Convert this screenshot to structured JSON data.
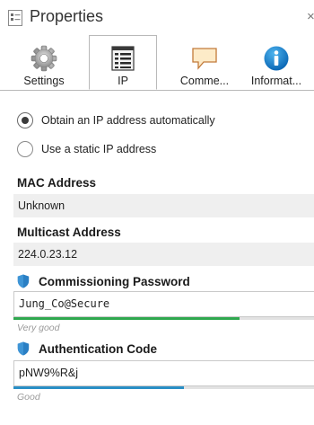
{
  "header": {
    "title": "Properties",
    "close_glyph": "×",
    "title_icon": "properties-icon"
  },
  "tabs": [
    {
      "label": "Settings",
      "icon": "gear-icon",
      "active": false
    },
    {
      "label": "IP",
      "icon": "ip-list-icon",
      "active": true
    },
    {
      "label": "Comme...",
      "icon": "comment-icon",
      "active": false
    },
    {
      "label": "Informat...",
      "icon": "info-icon",
      "active": false
    }
  ],
  "ip_mode": {
    "options": [
      {
        "label": "Obtain an IP address automatically",
        "checked": true
      },
      {
        "label": "Use a static IP address",
        "checked": false
      }
    ]
  },
  "mac": {
    "label": "MAC Address",
    "value": "Unknown"
  },
  "multicast": {
    "label": "Multicast Address",
    "value": "224.0.23.12"
  },
  "commissioning": {
    "label": "Commissioning Password",
    "value": "Jung_Co@Secure",
    "strength_text": "Very good",
    "strength_fraction": 0.74,
    "strength_color": "#2fa84f",
    "icon": "shield-icon"
  },
  "authentication": {
    "label": "Authentication Code",
    "value": "pNW9%R&j",
    "strength_text": "Good",
    "strength_fraction": 0.56,
    "strength_color": "#2a8fc6",
    "icon": "shield-icon"
  },
  "colors": {
    "shield": "#2a7fc4",
    "border": "#b9b9b9",
    "readonly_bg": "#efefef"
  }
}
